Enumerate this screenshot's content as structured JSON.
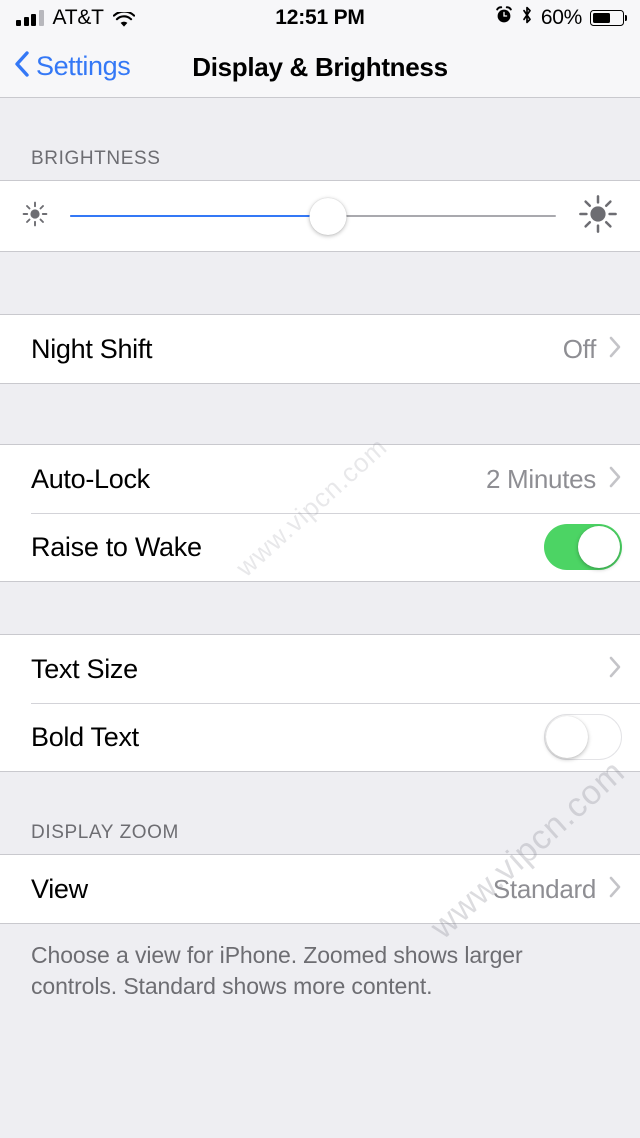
{
  "status_bar": {
    "carrier": "AT&T",
    "time": "12:51 PM",
    "battery_percent": "60%",
    "battery_level": 60,
    "signal_bars_filled": 3,
    "signal_bars_total": 4,
    "icons": [
      "signal-bars-icon",
      "wifi-icon",
      "alarm-clock-icon",
      "bluetooth-icon",
      "battery-icon"
    ]
  },
  "nav_bar": {
    "back_label": "Settings",
    "title": "Display & Brightness"
  },
  "sections": {
    "brightness": {
      "header": "BRIGHTNESS",
      "slider": {
        "value_percent": 53,
        "min_icon": "sun-small-icon",
        "max_icon": "sun-large-icon",
        "fill_color": "#3478f6",
        "track_color": "#a9a9ae"
      }
    },
    "night_shift": {
      "label": "Night Shift",
      "value": "Off"
    },
    "auto_lock": {
      "label": "Auto-Lock",
      "value": "2 Minutes"
    },
    "raise_to_wake": {
      "label": "Raise to Wake",
      "toggle_state": "on",
      "toggle_color": "#4cd464"
    },
    "text_size": {
      "label": "Text Size"
    },
    "bold_text": {
      "label": "Bold Text",
      "toggle_state": "off"
    },
    "display_zoom": {
      "header": "DISPLAY ZOOM",
      "view": {
        "label": "View",
        "value": "Standard"
      },
      "footer": "Choose a view for iPhone. Zoomed shows larger controls. Standard shows more content."
    }
  },
  "watermark": {
    "text": "www.vipcn.com"
  },
  "colors": {
    "accent_blue": "#3478f6",
    "toggle_green": "#4cd464",
    "group_background": "#ffffff",
    "page_background": "#eeeef2",
    "secondary_text": "#8e8e93",
    "header_text": "#6d6d72"
  }
}
